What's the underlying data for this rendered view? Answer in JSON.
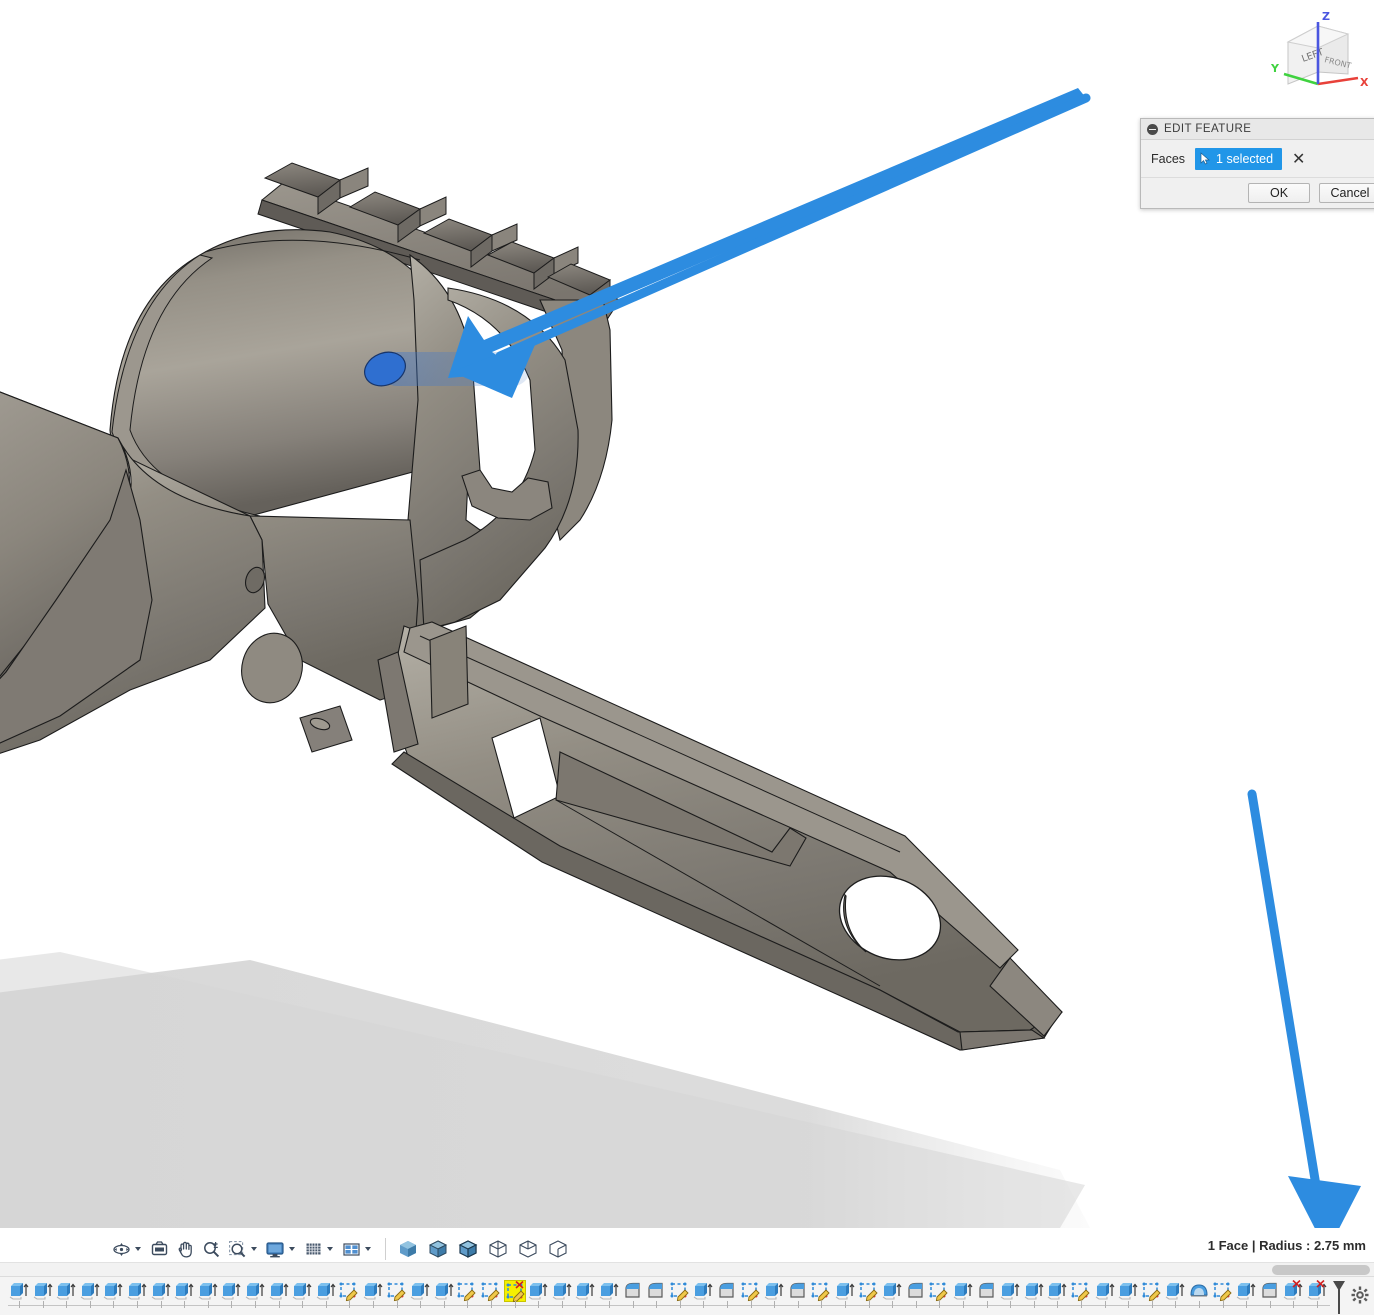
{
  "app": {
    "name": "fusion-360-cad",
    "background": "#ffffff",
    "model_color": "#8a857c",
    "accent_blue": "#2196e8",
    "annotation_arrow_color": "#2d8ce0",
    "selected_face_color": "#2f6fd0",
    "highlight_yellow": "#f5f000"
  },
  "viewcube": {
    "name": "view-cube",
    "visible_faces": [
      "LEFT",
      "FRONT"
    ],
    "axes": [
      {
        "label": "X",
        "color": "#e8413a"
      },
      {
        "label": "Y",
        "color": "#3fd23f"
      },
      {
        "label": "Z",
        "color": "#4a56e0"
      }
    ]
  },
  "edit_dialog": {
    "title": "EDIT FEATURE",
    "collapse_icon": "minus-circle-icon",
    "rows": [
      {
        "label": "Faces",
        "selection_value": "1 selected",
        "selection_icon": "cursor-arrow-icon",
        "clear_icon": "close-x-icon"
      }
    ],
    "buttons": [
      {
        "label": "OK",
        "role": "confirm"
      },
      {
        "label": "Cancel",
        "role": "dismiss"
      }
    ]
  },
  "status_bar": {
    "text": "1 Face | Radius : 2.75 mm",
    "face_count": "1 Face",
    "radius_label": "Radius",
    "radius_value": "2.75 mm"
  },
  "navbar": {
    "items": [
      {
        "name": "orbit-icon",
        "label": "Orbit",
        "has_caret": true
      },
      {
        "name": "look-at-icon",
        "label": "Look At",
        "has_caret": false
      },
      {
        "name": "pan-hand-icon",
        "label": "Pan",
        "has_caret": false
      },
      {
        "name": "zoom-magnifier-icon",
        "label": "Zoom",
        "has_caret": false
      },
      {
        "name": "zoom-window-icon",
        "label": "Fit",
        "has_caret": true
      },
      {
        "name": "display-settings-icon",
        "label": "Display Settings",
        "has_caret": true
      },
      {
        "name": "grid-snaps-icon",
        "label": "Grid and Snaps",
        "has_caret": true
      },
      {
        "name": "viewports-icon",
        "label": "Viewports",
        "has_caret": true
      }
    ],
    "visual_styles": [
      {
        "name": "shaded-icon",
        "label": "Shaded"
      },
      {
        "name": "shaded-hidden-edges-icon",
        "label": "Shaded with Hidden Edges"
      },
      {
        "name": "shaded-visible-edges-icon",
        "label": "Shaded with Visible Edges"
      },
      {
        "name": "wireframe-hidden-icon",
        "label": "Wireframe"
      },
      {
        "name": "wireframe-visible-icon",
        "label": "Wireframe with Visible Edges Only"
      },
      {
        "name": "wireframe-plain-icon",
        "label": "Wireframe Only"
      }
    ]
  },
  "scrollbar": {
    "name": "timeline-horizontal-scrollbar",
    "thumb_position": "right"
  },
  "timeline": {
    "end_marker": "timeline-playhead-marker",
    "settings_icon": "gear-icon",
    "selected_index": 21,
    "features": [
      {
        "type": "extrude",
        "suppressed": false
      },
      {
        "type": "extrude",
        "suppressed": false
      },
      {
        "type": "extrude",
        "suppressed": false
      },
      {
        "type": "extrude",
        "suppressed": false
      },
      {
        "type": "extrude",
        "suppressed": false
      },
      {
        "type": "extrude",
        "suppressed": false
      },
      {
        "type": "extrude",
        "suppressed": false
      },
      {
        "type": "extrude",
        "suppressed": false
      },
      {
        "type": "extrude",
        "suppressed": false
      },
      {
        "type": "extrude",
        "suppressed": false
      },
      {
        "type": "extrude",
        "suppressed": false
      },
      {
        "type": "extrude",
        "suppressed": false
      },
      {
        "type": "extrude",
        "suppressed": false
      },
      {
        "type": "extrude",
        "suppressed": false
      },
      {
        "type": "sketch",
        "suppressed": false
      },
      {
        "type": "extrude",
        "suppressed": false
      },
      {
        "type": "sketch",
        "suppressed": false
      },
      {
        "type": "extrude",
        "suppressed": false
      },
      {
        "type": "extrude",
        "suppressed": false
      },
      {
        "type": "sketch",
        "suppressed": false
      },
      {
        "type": "sketch",
        "suppressed": false
      },
      {
        "type": "sketch",
        "suppressed": true
      },
      {
        "type": "extrude",
        "suppressed": false
      },
      {
        "type": "extrude",
        "suppressed": false
      },
      {
        "type": "extrude",
        "suppressed": false
      },
      {
        "type": "extrude",
        "suppressed": false
      },
      {
        "type": "fillet",
        "suppressed": false
      },
      {
        "type": "fillet",
        "suppressed": false
      },
      {
        "type": "sketch",
        "suppressed": false
      },
      {
        "type": "extrude",
        "suppressed": false
      },
      {
        "type": "fillet",
        "suppressed": false
      },
      {
        "type": "sketch",
        "suppressed": false
      },
      {
        "type": "extrude",
        "suppressed": false
      },
      {
        "type": "fillet",
        "suppressed": false
      },
      {
        "type": "sketch",
        "suppressed": false
      },
      {
        "type": "extrude",
        "suppressed": false
      },
      {
        "type": "sketch",
        "suppressed": false
      },
      {
        "type": "extrude",
        "suppressed": false
      },
      {
        "type": "fillet",
        "suppressed": false
      },
      {
        "type": "sketch",
        "suppressed": false
      },
      {
        "type": "extrude",
        "suppressed": false
      },
      {
        "type": "fillet",
        "suppressed": false
      },
      {
        "type": "extrude",
        "suppressed": false
      },
      {
        "type": "extrude",
        "suppressed": false
      },
      {
        "type": "extrude",
        "suppressed": false
      },
      {
        "type": "sketch",
        "suppressed": false
      },
      {
        "type": "extrude",
        "suppressed": false
      },
      {
        "type": "extrude",
        "suppressed": false
      },
      {
        "type": "sketch",
        "suppressed": false
      },
      {
        "type": "extrude",
        "suppressed": false
      },
      {
        "type": "shell",
        "suppressed": false
      },
      {
        "type": "sketch",
        "suppressed": false
      },
      {
        "type": "extrude",
        "suppressed": false
      },
      {
        "type": "fillet",
        "suppressed": false
      },
      {
        "type": "extrude",
        "suppressed": true
      },
      {
        "type": "extrude",
        "suppressed": true
      }
    ]
  },
  "annotations": [
    {
      "name": "arrow-to-selected-face",
      "type": "arrow",
      "from": [
        1090,
        96
      ],
      "to": [
        452,
        372
      ]
    },
    {
      "name": "arrow-to-radius-status",
      "type": "arrow",
      "from": [
        1253,
        792
      ],
      "to": [
        1327,
        1252
      ]
    }
  ],
  "model": {
    "name": "revolver-frame-3d-model",
    "selected_face": {
      "name": "filleted-edge-face",
      "color": "#2f6fd0",
      "highlighted": true
    }
  }
}
